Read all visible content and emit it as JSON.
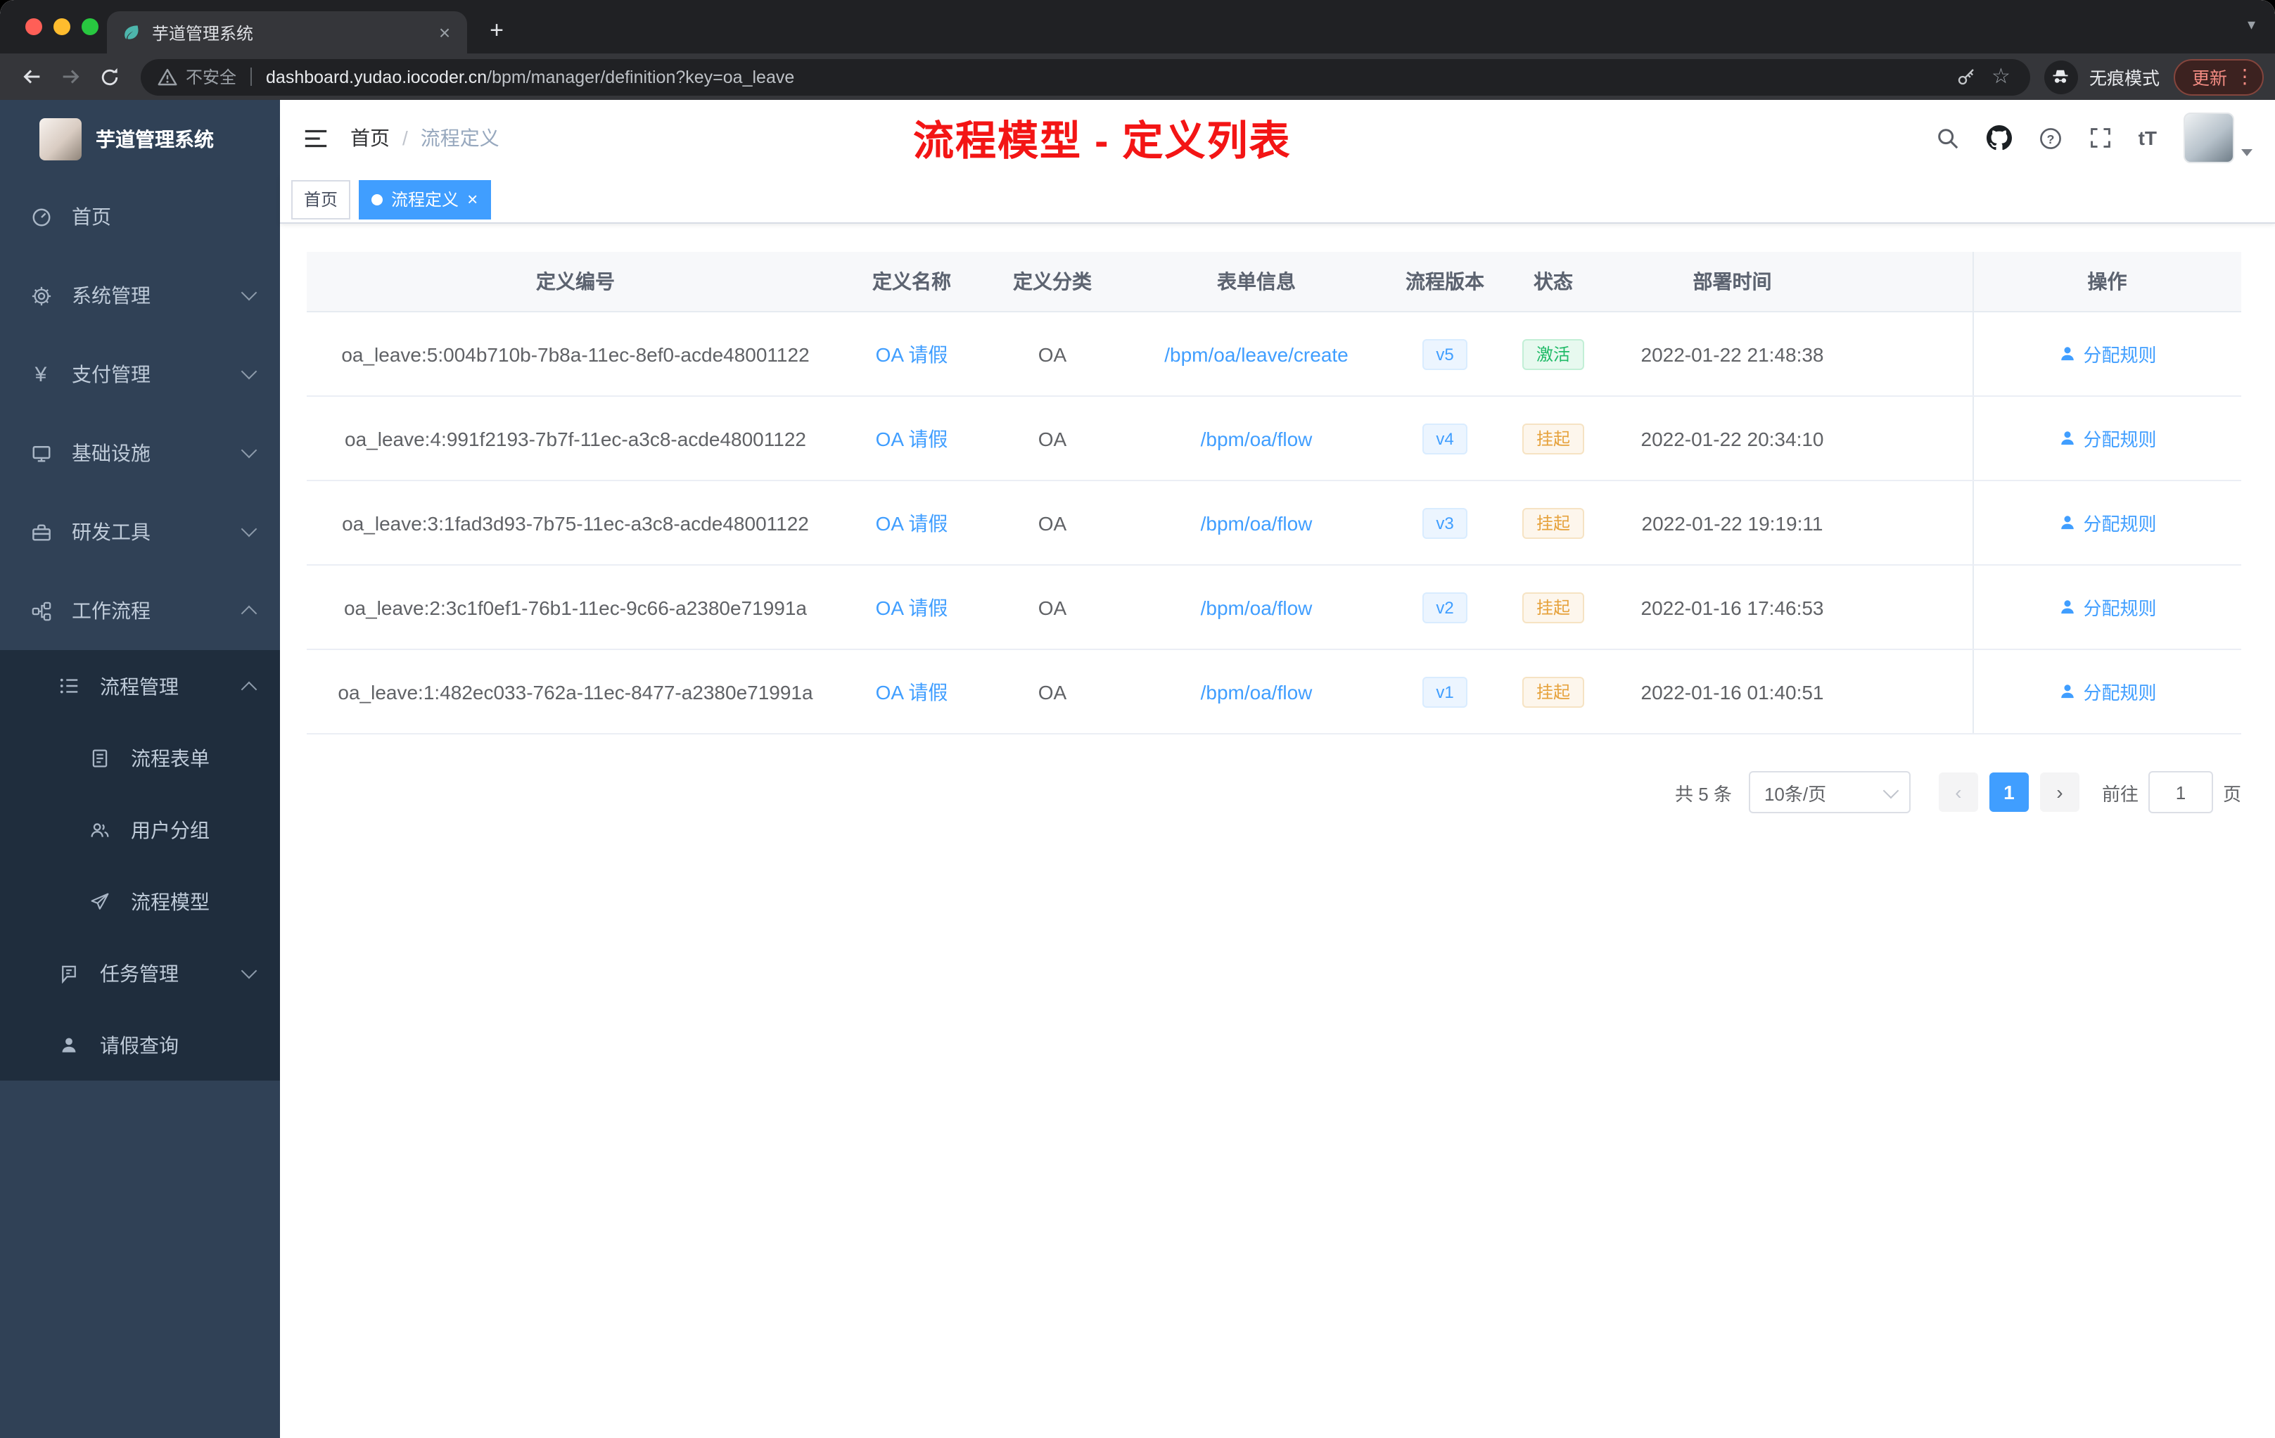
{
  "glyphs": {
    "close": "×",
    "plus": "+",
    "caret_down": "▾",
    "star": "☆",
    "dots": "⋮",
    "prev": "‹",
    "next": "›",
    "font_size_icon": "tT",
    "yen": "¥"
  },
  "browser": {
    "tab_title": "芋道管理系统",
    "security_label": "不安全",
    "url_domain": "dashboard.yudao.iocoder.cn",
    "url_path": "/bpm/manager/definition?key=oa_leave",
    "incognito_label": "无痕模式",
    "update_label": "更新"
  },
  "sidebar": {
    "app_title": "芋道管理系统",
    "items": [
      {
        "label": "首页"
      },
      {
        "label": "系统管理"
      },
      {
        "label": "支付管理"
      },
      {
        "label": "基础设施"
      },
      {
        "label": "研发工具"
      },
      {
        "label": "工作流程"
      },
      {
        "label": "流程管理"
      },
      {
        "label": "流程表单"
      },
      {
        "label": "用户分组"
      },
      {
        "label": "流程模型"
      },
      {
        "label": "任务管理"
      },
      {
        "label": "请假查询"
      }
    ]
  },
  "header": {
    "breadcrumb": {
      "home": "首页",
      "separator": "/",
      "current": "流程定义"
    },
    "annotation": "流程模型 - 定义列表"
  },
  "tags": {
    "home": "首页",
    "current": "流程定义"
  },
  "table": {
    "columns": [
      "定义编号",
      "定义名称",
      "定义分类",
      "表单信息",
      "流程版本",
      "状态",
      "部署时间",
      "操作"
    ],
    "rows": [
      {
        "id": "oa_leave:5:004b710b-7b8a-11ec-8ef0-acde48001122",
        "name": "OA 请假",
        "category": "OA",
        "form": "/bpm/oa/leave/create",
        "version": "v5",
        "status": "激活",
        "deploy_time": "2022-01-22 21:48:38",
        "action": "分配规则"
      },
      {
        "id": "oa_leave:4:991f2193-7b7f-11ec-a3c8-acde48001122",
        "name": "OA 请假",
        "category": "OA",
        "form": "/bpm/oa/flow",
        "version": "v4",
        "status": "挂起",
        "deploy_time": "2022-01-22 20:34:10",
        "action": "分配规则"
      },
      {
        "id": "oa_leave:3:1fad3d93-7b75-11ec-a3c8-acde48001122",
        "name": "OA 请假",
        "category": "OA",
        "form": "/bpm/oa/flow",
        "version": "v3",
        "status": "挂起",
        "deploy_time": "2022-01-22 19:19:11",
        "action": "分配规则"
      },
      {
        "id": "oa_leave:2:3c1f0ef1-76b1-11ec-9c66-a2380e71991a",
        "name": "OA 请假",
        "category": "OA",
        "form": "/bpm/oa/flow",
        "version": "v2",
        "status": "挂起",
        "deploy_time": "2022-01-16 17:46:53",
        "action": "分配规则"
      },
      {
        "id": "oa_leave:1:482ec033-762a-11ec-8477-a2380e71991a",
        "name": "OA 请假",
        "category": "OA",
        "form": "/bpm/oa/flow",
        "version": "v1",
        "status": "挂起",
        "deploy_time": "2022-01-16 01:40:51",
        "action": "分配规则"
      }
    ]
  },
  "pagination": {
    "total": "共 5 条",
    "page_size": "10条/页",
    "current_page": "1",
    "goto_label": "前往",
    "page_unit": "页",
    "goto_value": "1"
  },
  "colors": {
    "accent": "#409eff",
    "success": "#1fba67",
    "warning": "#e6a23c",
    "annotation_red": "#f31515",
    "sidebar_bg": "#304156",
    "submenu_bg": "#1f2d3d"
  }
}
